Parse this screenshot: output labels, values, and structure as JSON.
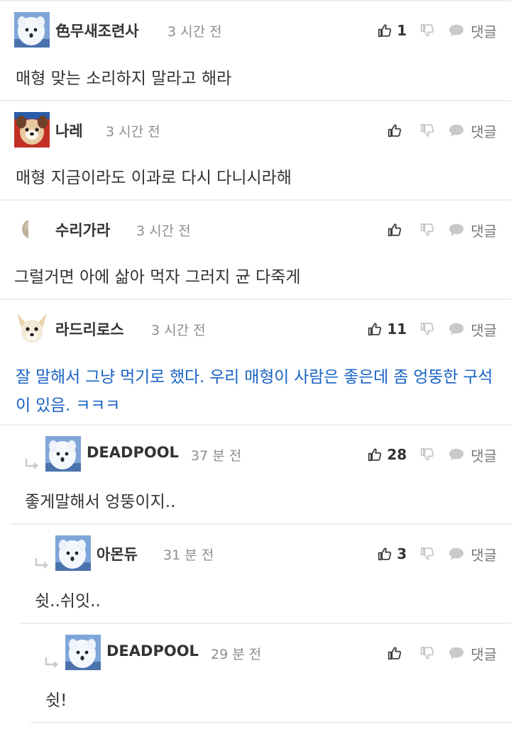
{
  "labels": {
    "reply": "댓글"
  },
  "comments": [
    {
      "nickname": "色무새조련사",
      "time": "3 시간 전",
      "upvotes": "1",
      "text": "매형 맞는 소리하지 말라고 해라"
    },
    {
      "nickname": "나레",
      "time": "3 시간 전",
      "upvotes": "",
      "text": "매형 지금이라도 이과로 다시 다니시라해"
    },
    {
      "nickname": "수리가라",
      "time": "3 시간 전",
      "upvotes": "",
      "text": "그럴거면 아에 삶아 먹자 그러지 균 다죽게"
    },
    {
      "nickname": "라드리로스",
      "time": "3 시간 전",
      "upvotes": "11",
      "text": "잘 말해서 그냥 먹기로 했다. 우리 매형이 사람은 좋은데 좀 엉뚱한 구석이 있음. ㅋㅋㅋ",
      "highlight_color": "#1a63c4"
    },
    {
      "nickname": "DEADPOOL",
      "time": "37 분 전",
      "upvotes": "28",
      "text": "좋게말해서 엉뚱이지.."
    },
    {
      "nickname": "아몬듀",
      "time": "31 분 전",
      "upvotes": "3",
      "text": "쉿..쉬잇.."
    },
    {
      "nickname": "DEADPOOL",
      "time": "29 분 전",
      "upvotes": "",
      "text": "쉿!"
    }
  ],
  "icons": {
    "upvote": "thumbs-up-icon",
    "downvote": "thumbs-down-icon",
    "reply": "speech-bubble-icon",
    "reply_indicator": "reply-arrow-icon"
  },
  "colors": {
    "highlight_text": "#1a63c4",
    "timestamp": "#8d8d8d",
    "divider": "#eeeeee"
  }
}
